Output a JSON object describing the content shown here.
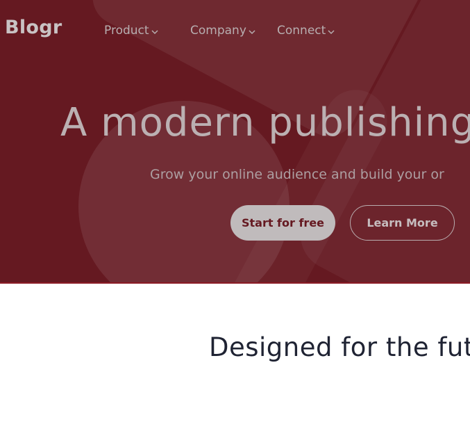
{
  "brand": {
    "logo": "Blogr"
  },
  "nav": {
    "items": [
      {
        "label": "Product"
      },
      {
        "label": "Company"
      },
      {
        "label": "Connect"
      }
    ]
  },
  "hero": {
    "title": "A modern publishing",
    "subtitle": "Grow your online audience and build your or",
    "primary_button": "Start for free",
    "secondary_button": "Learn More"
  },
  "section": {
    "title": "Designed for the futur"
  },
  "colors": {
    "hero_background": "#651921",
    "hero_accent_line": "#8c1c26",
    "section_text": "#1f2333"
  }
}
